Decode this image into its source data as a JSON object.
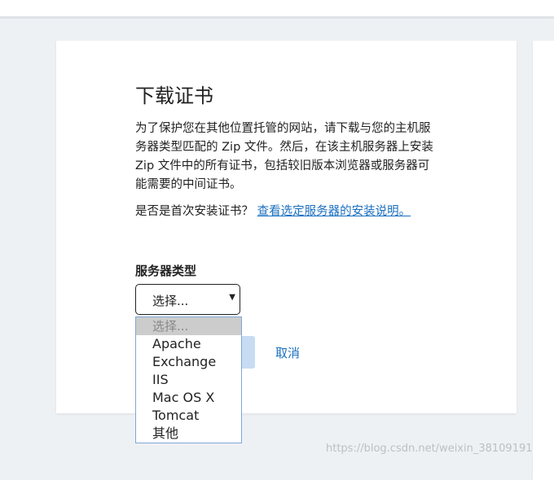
{
  "page": {
    "title": "下载证书",
    "description": "为了保护您在其他位置托管的网站，请下载与您的主机服务器类型匹配的 Zip 文件。然后，在该主机服务器上安装 Zip 文件中的所有证书，包括较旧版本浏览器或服务器可能需要的中间证书。",
    "first_time_question": "是否是首次安装证书？",
    "install_link": "查看选定服务器的安装说明。"
  },
  "server": {
    "label": "服务器类型",
    "selected": "选择...",
    "options": [
      "选择...",
      "Apache",
      "Exchange",
      "IIS",
      "Mac OS X",
      "Tomcat",
      "其他"
    ]
  },
  "actions": {
    "cancel_label": "取消"
  },
  "watermark": "https://blog.csdn.net/weixin_38109191",
  "colors": {
    "link": "#1a6fbf",
    "background": "#eef1f4",
    "button_disabled": "#c7dcf2"
  }
}
